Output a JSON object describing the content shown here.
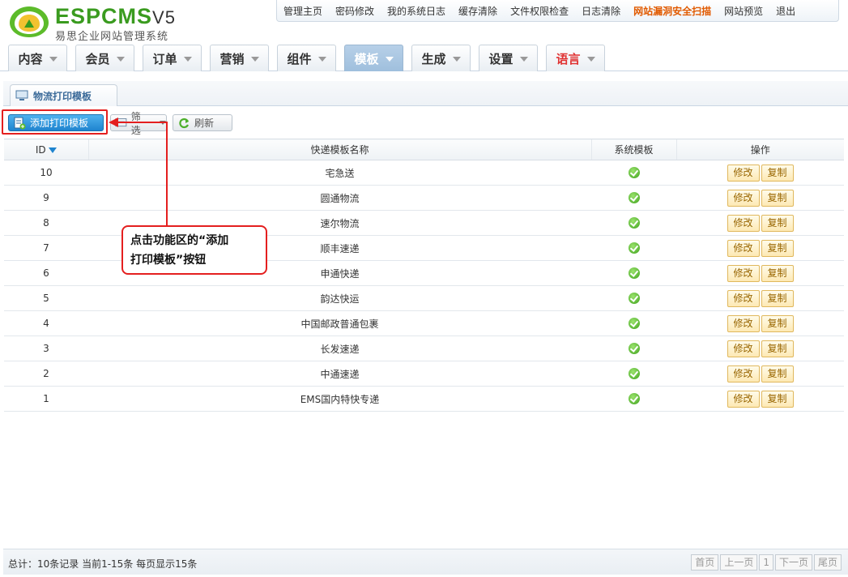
{
  "brand": {
    "logo": "ESPCMS",
    "version": "V5",
    "subtitle": "易思企业网站管理系统"
  },
  "topnav": [
    {
      "label": "管理主页",
      "warn": false
    },
    {
      "label": "密码修改",
      "warn": false
    },
    {
      "label": "我的系统日志",
      "warn": false
    },
    {
      "label": "缓存清除",
      "warn": false
    },
    {
      "label": "文件权限检查",
      "warn": false
    },
    {
      "label": "日志清除",
      "warn": false
    },
    {
      "label": "网站漏洞安全扫描",
      "warn": true
    },
    {
      "label": "网站预览",
      "warn": false
    },
    {
      "label": "退出",
      "warn": false
    }
  ],
  "mainnav": [
    "内容",
    "会员",
    "订单",
    "营销",
    "组件",
    "模板",
    "生成",
    "设置",
    "语言"
  ],
  "mainnav_active": "模板",
  "page_tab": "物流打印模板",
  "toolbar": {
    "add_label": "添加打印模板",
    "filter_label": "筛选",
    "refresh_label": "刷新"
  },
  "table": {
    "headers": {
      "id": "ID",
      "name": "快递模板名称",
      "system": "系统模板",
      "ops": "操作"
    },
    "edit_label": "修改",
    "copy_label": "复制",
    "rows": [
      {
        "id": "10",
        "name": "宅急送"
      },
      {
        "id": "9",
        "name": "圆通物流"
      },
      {
        "id": "8",
        "name": "速尔物流"
      },
      {
        "id": "7",
        "name": "顺丰速递"
      },
      {
        "id": "6",
        "name": "申通快递"
      },
      {
        "id": "5",
        "name": "韵达快运"
      },
      {
        "id": "4",
        "name": "中国邮政普通包裹"
      },
      {
        "id": "3",
        "name": "长发速递"
      },
      {
        "id": "2",
        "name": "中通速递"
      },
      {
        "id": "1",
        "name": "EMS国内特快专递"
      }
    ]
  },
  "callout": {
    "line1": "点击功能区的“添加",
    "line2": "打印模板”按钮"
  },
  "footer": {
    "summary": "总计：10条记录 当前1-15条 每页显示15条"
  },
  "pager": [
    "首页",
    "上一页",
    "1",
    "下一页",
    "尾页"
  ],
  "colors": {
    "accent": "#1f84cf",
    "annotation": "#e41f1f",
    "warn": "#e15a00",
    "brand": "#3a9b1f"
  }
}
